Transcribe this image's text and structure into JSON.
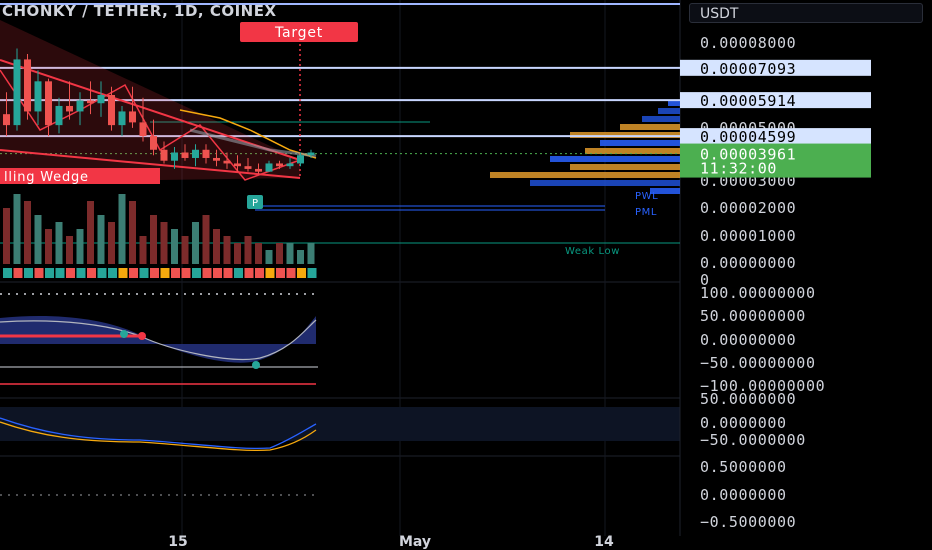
{
  "header": {
    "title": "CHONKY / TETHER, 1D, COINEX",
    "currency": "USDT"
  },
  "colors": {
    "bull": "#26a69a",
    "bear": "#ef5350",
    "background": "#000000",
    "countdown_bg": "#4caf50",
    "level_box": "#d6e4ff"
  },
  "annotations": {
    "target": "Target",
    "wedge": "lling Wedge",
    "weak_low": "Weak Low",
    "pwl": "PWL",
    "pml": "PML",
    "p_marker": "P"
  },
  "price_levels": [
    {
      "label": "0.00007093",
      "value": 7.093e-05
    },
    {
      "label": "0.00005914",
      "value": 5.914e-05
    },
    {
      "label": "0.00004599",
      "value": 4.599e-05
    }
  ],
  "current_price": {
    "label": "0.00003961",
    "countdown": "11:32:00",
    "value": 3.961e-05
  },
  "chart_data": [
    {
      "type": "line",
      "title": "CHONKY / TETHER, 1D, COINEX",
      "price_axis": {
        "ticks": [
          "0.00008000",
          "0.00005000",
          "0.00003000",
          "0.00002000",
          "0.00001000",
          "0.00000000",
          "0"
        ]
      },
      "time_axis": {
        "ticks": [
          "15",
          "May",
          "14"
        ]
      },
      "volume_values": [
        8,
        10,
        9,
        7,
        5,
        6,
        4,
        5,
        9,
        7,
        6,
        10,
        9,
        4,
        7,
        6,
        5,
        4,
        6,
        7,
        5,
        4,
        3,
        4,
        3,
        2,
        3,
        3,
        2,
        3
      ],
      "ohlc": [
        [
          5.4e-05,
          6.2e-05,
          4.6e-05,
          5e-05
        ],
        [
          5e-05,
          7.8e-05,
          4.8e-05,
          7.4e-05
        ],
        [
          7.4e-05,
          7.6e-05,
          5.2e-05,
          5.5e-05
        ],
        [
          5.5e-05,
          7e-05,
          5e-05,
          6.6e-05
        ],
        [
          6.6e-05,
          6.7e-05,
          4.6e-05,
          5e-05
        ],
        [
          5e-05,
          6e-05,
          4.7e-05,
          5.7e-05
        ],
        [
          5.7e-05,
          6.6e-05,
          5.2e-05,
          5.5e-05
        ],
        [
          5.5e-05,
          6.2e-05,
          5e-05,
          5.9e-05
        ],
        [
          5.9e-05,
          6.6e-05,
          5.4e-05,
          5.8e-05
        ],
        [
          5.8e-05,
          6.6e-05,
          5.3e-05,
          6.1e-05
        ],
        [
          6.1e-05,
          6.4e-05,
          4.8e-05,
          5e-05
        ],
        [
          5e-05,
          5.7e-05,
          4.6e-05,
          5.5e-05
        ],
        [
          5.5e-05,
          6.4e-05,
          4.9e-05,
          5.1e-05
        ],
        [
          5.1e-05,
          6e-05,
          4.4e-05,
          4.6e-05
        ],
        [
          4.6e-05,
          5.2e-05,
          3.9e-05,
          4.1e-05
        ],
        [
          4.1e-05,
          4.4e-05,
          3.6e-05,
          3.7e-05
        ],
        [
          3.7e-05,
          4.2e-05,
          3.4e-05,
          4e-05
        ],
        [
          4e-05,
          4.3e-05,
          3.7e-05,
          3.8e-05
        ],
        [
          3.8e-05,
          4.3e-05,
          3.5e-05,
          4.1e-05
        ],
        [
          4.1e-05,
          4.3e-05,
          3.6e-05,
          3.8e-05
        ],
        [
          3.8e-05,
          4.1e-05,
          3.5e-05,
          3.7e-05
        ],
        [
          3.7e-05,
          4e-05,
          3.4e-05,
          3.6e-05
        ],
        [
          3.6e-05,
          3.9e-05,
          3.3e-05,
          3.5e-05
        ],
        [
          3.5e-05,
          3.8e-05,
          3.3e-05,
          3.4e-05
        ],
        [
          3.4e-05,
          3.6e-05,
          3.2e-05,
          3.3e-05
        ],
        [
          3.3e-05,
          3.7e-05,
          3.3e-05,
          3.6e-05
        ],
        [
          3.6e-05,
          3.7e-05,
          3.4e-05,
          3.5e-05
        ],
        [
          3.5e-05,
          3.8e-05,
          3.4e-05,
          3.6e-05
        ],
        [
          3.6e-05,
          4e-05,
          3.5e-05,
          3.9e-05
        ],
        [
          3.9e-05,
          4.1e-05,
          3.8e-05,
          4e-05
        ]
      ]
    },
    {
      "type": "line",
      "y_axis_ticks": [
        "100.00000000",
        "50.00000000",
        "0.00000000",
        "−50.00000000",
        "−100.00000000"
      ]
    },
    {
      "type": "line",
      "y_axis_ticks": [
        "50.0000000",
        "0.0000000",
        "−50.0000000"
      ]
    },
    {
      "type": "line",
      "y_axis_ticks": [
        "0.5000000",
        "0.0000000",
        "−0.5000000"
      ]
    }
  ]
}
